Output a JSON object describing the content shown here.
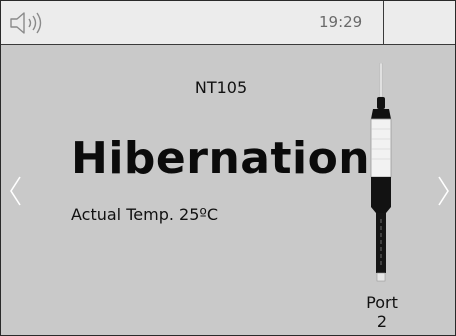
{
  "status_bar": {
    "time": "19:29",
    "sound_icon": "speaker-sound-icon"
  },
  "sensor": {
    "name": "NT105",
    "mode": "Hibernation",
    "temperature_label": "Actual Temp. 25ºC"
  },
  "port": {
    "label": "Port",
    "number": "2"
  },
  "navigation": {
    "prev_icon": "chevron-left-icon",
    "next_icon": "chevron-right-icon"
  }
}
